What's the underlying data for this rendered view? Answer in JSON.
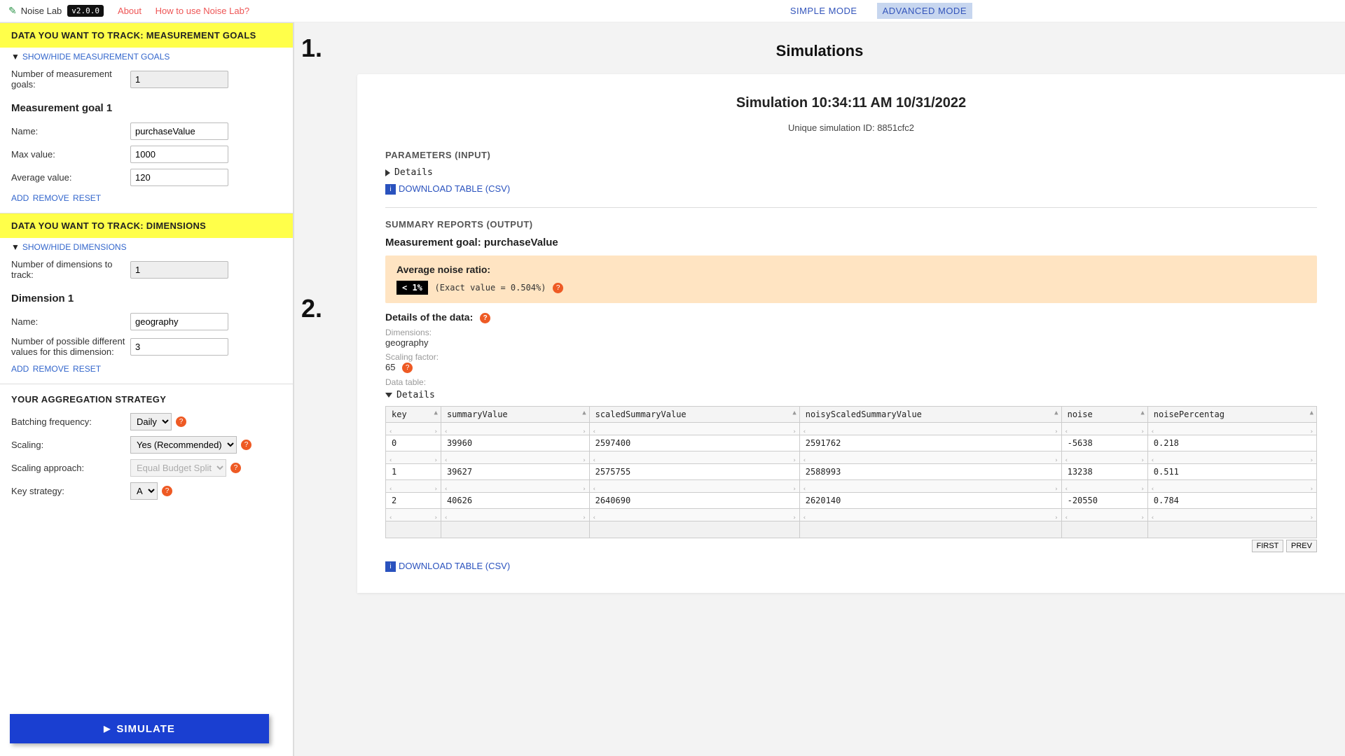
{
  "app": {
    "name": "Noise Lab",
    "version": "v2.0.0",
    "links": {
      "about": "About",
      "howto": "How to use Noise Lab?"
    },
    "modes": {
      "simple": "SIMPLE MODE",
      "advanced": "ADVANCED MODE"
    }
  },
  "sidebar": {
    "sec1_title": "DATA YOU WANT TO TRACK: MEASUREMENT GOALS",
    "toggle1": "SHOW/HIDE MEASUREMENT GOALS",
    "num_goals_lbl": "Number of measurement goals:",
    "num_goals": "1",
    "goal1": {
      "heading": "Measurement goal 1",
      "name_lbl": "Name:",
      "name": "purchaseValue",
      "max_lbl": "Max value:",
      "max": "1000",
      "avg_lbl": "Average value:",
      "avg": "120"
    },
    "actions": {
      "add": "ADD",
      "remove": "REMOVE",
      "reset": "RESET"
    },
    "sec2_title": "DATA YOU WANT TO TRACK: DIMENSIONS",
    "toggle2": "SHOW/HIDE DIMENSIONS",
    "num_dims_lbl": "Number of dimensions to track:",
    "num_dims": "1",
    "dim1": {
      "heading": "Dimension 1",
      "name_lbl": "Name:",
      "name": "geography",
      "num_vals_lbl": "Number of possible different values for this dimension:",
      "num_vals": "3"
    },
    "agg_title": "YOUR AGGREGATION STRATEGY",
    "batch_lbl": "Batching frequency:",
    "batch_val": "Daily",
    "scaling_lbl": "Scaling:",
    "scaling_val": "Yes (Recommended)",
    "scaling_approach_lbl": "Scaling approach:",
    "scaling_approach_val": "Equal Budget Split",
    "key_strategy_lbl": "Key strategy:",
    "key_strategy_val": "A",
    "simulate_btn": "SIMULATE"
  },
  "main": {
    "title": "Simulations",
    "sim_heading": "Simulation 10:34:11 AM 10/31/2022",
    "sim_id_text": "Unique simulation ID: 8851cfc2",
    "params_title": "PARAMETERS (INPUT)",
    "details_label": "Details",
    "download_table": "DOWNLOAD TABLE (CSV)",
    "summary_title": "SUMMARY REPORTS (OUTPUT)",
    "mg_title": "Measurement goal: purchaseValue",
    "noise": {
      "label": "Average noise ratio:",
      "badge": "< 1%",
      "exact": "(Exact value = 0.504%)"
    },
    "details_of": "Details of the data:",
    "dimensions_lbl": "Dimensions:",
    "dimensions_val": "geography",
    "scaling_factor_lbl": "Scaling factor:",
    "scaling_factor_val": "65",
    "data_table_lbl": "Data table:",
    "columns": [
      "key",
      "summaryValue",
      "scaledSummaryValue",
      "noisyScaledSummaryValue",
      "noise",
      "noisePercentag"
    ],
    "rows": [
      [
        "0",
        "39960",
        "2597400",
        "2591762",
        "-5638",
        "0.218"
      ],
      [
        "1",
        "39627",
        "2575755",
        "2588993",
        "13238",
        "0.511"
      ],
      [
        "2",
        "40626",
        "2640690",
        "2620140",
        "-20550",
        "0.784"
      ]
    ],
    "pager": {
      "first": "FIRST",
      "prev": "PREV"
    }
  },
  "annotations": {
    "one": "1.",
    "two": "2."
  }
}
